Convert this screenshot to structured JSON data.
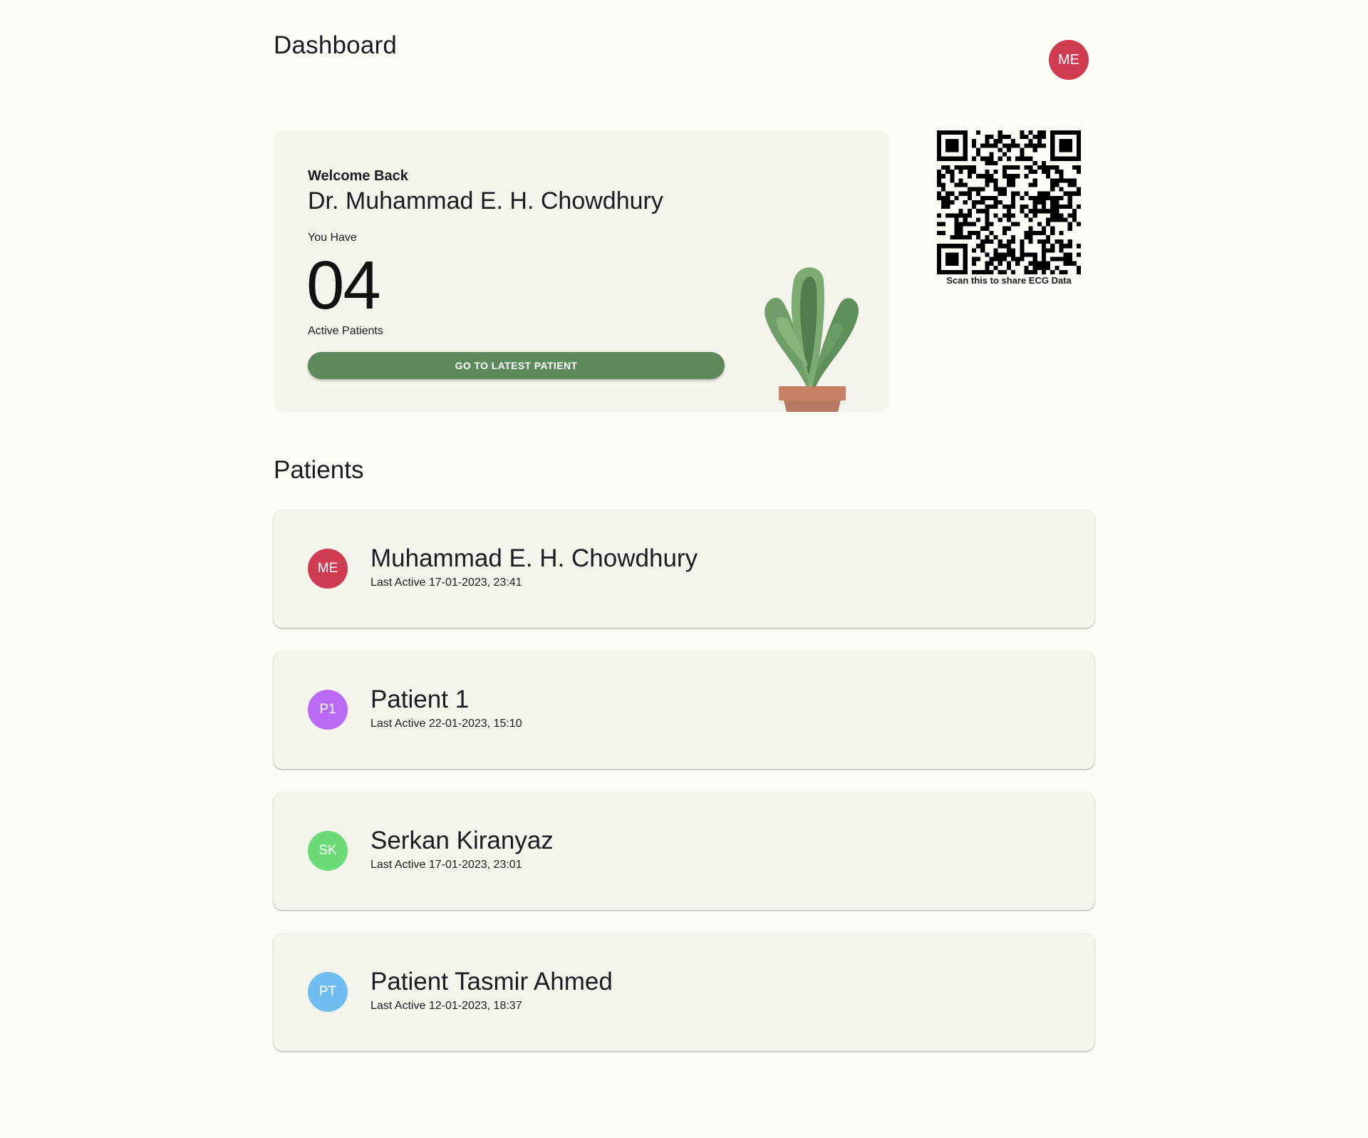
{
  "header": {
    "title": "Dashboard",
    "avatar_initials": "ME",
    "avatar_color": "#cf3b50"
  },
  "welcome": {
    "greeting": "Welcome Back",
    "doctor_name": "Dr. Muhammad E. H. Chowdhury",
    "you_have": "You Have",
    "count": "04",
    "count_label": "Active Patients",
    "button_label": "GO TO LATEST PATIENT",
    "accent": "#5d8a5d"
  },
  "qr": {
    "caption": "Scan this to share ECG Data"
  },
  "patients_section": {
    "title": "Patients"
  },
  "patients": [
    {
      "initials": "ME",
      "name": "Muhammad E. H. Chowdhury",
      "last_active": "Last Active 17-01-2023, 23:41",
      "color": "#cf3b50"
    },
    {
      "initials": "P1",
      "name": "Patient 1",
      "last_active": "Last Active 22-01-2023, 15:10",
      "color": "#b96af5"
    },
    {
      "initials": "SK",
      "name": "Serkan Kiranyaz",
      "last_active": "Last Active 17-01-2023, 23:01",
      "color": "#6bdc75"
    },
    {
      "initials": "PT",
      "name": "Patient Tasmir Ahmed",
      "last_active": "Last Active 12-01-2023, 18:37",
      "color": "#6ebcf0"
    }
  ]
}
